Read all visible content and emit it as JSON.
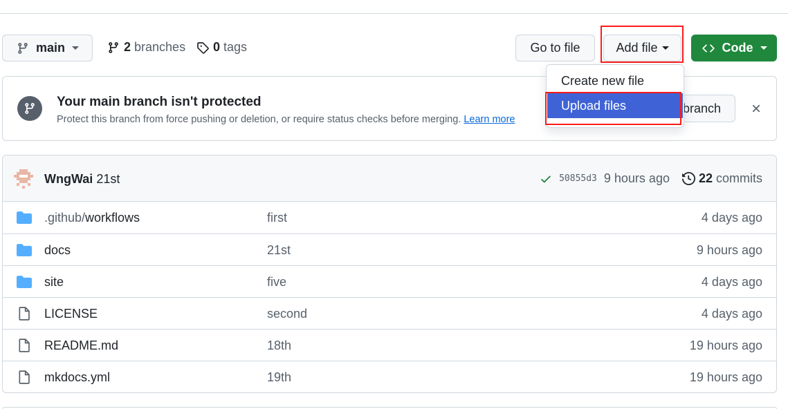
{
  "toolbar": {
    "branch_name": "main",
    "branches_count": "2",
    "branches_label": "branches",
    "tags_count": "0",
    "tags_label": "tags",
    "go_to_file": "Go to file",
    "add_file": "Add file",
    "code": "Code"
  },
  "add_file_menu": {
    "items": [
      {
        "label": "Create new file"
      },
      {
        "label": "Upload files"
      }
    ]
  },
  "banner": {
    "title": "Your main branch isn't protected",
    "description": "Protect this branch from force pushing or deletion, or require status checks before merging.",
    "learn_more": "Learn more",
    "protect_button": "branch"
  },
  "commit": {
    "author": "WngWai",
    "message": "21st",
    "sha": "50855d3",
    "time": "9 hours ago",
    "commits_count": "22",
    "commits_label": "commits"
  },
  "files": [
    {
      "type": "folder",
      "name_prefix": ".github/",
      "name": "workflows",
      "message": "first",
      "age": "4 days ago"
    },
    {
      "type": "folder",
      "name_prefix": "",
      "name": "docs",
      "message": "21st",
      "age": "9 hours ago"
    },
    {
      "type": "folder",
      "name_prefix": "",
      "name": "site",
      "message": "five",
      "age": "4 days ago"
    },
    {
      "type": "file",
      "name_prefix": "",
      "name": "LICENSE",
      "message": "second",
      "age": "4 days ago"
    },
    {
      "type": "file",
      "name_prefix": "",
      "name": "README.md",
      "message": "18th",
      "age": "19 hours ago"
    },
    {
      "type": "file",
      "name_prefix": "",
      "name": "mkdocs.yml",
      "message": "19th",
      "age": "19 hours ago"
    }
  ],
  "colors": {
    "primary_green": "#1f883d",
    "menu_highlight": "#3f63d6",
    "annotation_red": "#ff1a1a",
    "folder_blue": "#54aeff",
    "link_blue": "#0969da"
  }
}
